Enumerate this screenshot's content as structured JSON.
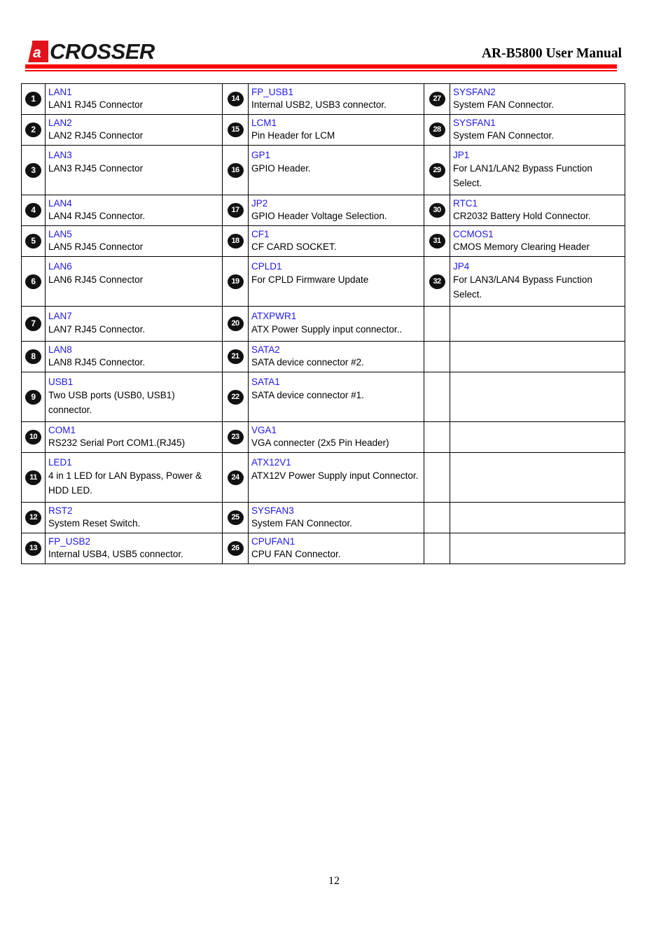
{
  "header": {
    "logo_text": "CROSSER",
    "logo_mark_letter": "a",
    "title": "AR-B5800 User Manual",
    "rule_color": "#fd0000",
    "logo_color": "#e1131d"
  },
  "theme": {
    "title_link_color": "#1f18f0",
    "badge_bg": "#111111",
    "badge_fg": "#ffffff",
    "border_color": "#000000"
  },
  "table": {
    "columns": [
      {
        "items": [
          {
            "num": "1",
            "title": "LAN1",
            "desc": "LAN1 RJ45 Connector"
          },
          {
            "num": "2",
            "title": "LAN2",
            "desc": "LAN2 RJ45 Connector"
          },
          {
            "num": "3",
            "title": "LAN3",
            "desc": "LAN3 RJ45 Connector"
          },
          {
            "num": "4",
            "title": "LAN4",
            "desc": "LAN4 RJ45 Connector."
          },
          {
            "num": "5",
            "title": "LAN5",
            "desc": "LAN5 RJ45 Connector"
          },
          {
            "num": "6",
            "title": "LAN6",
            "desc": "LAN6 RJ45 Connector"
          },
          {
            "num": "7",
            "title": "LAN7",
            "desc": "LAN7 RJ45 Connector."
          },
          {
            "num": "8",
            "title": "LAN8",
            "desc": "LAN8 RJ45 Connector."
          },
          {
            "num": "9",
            "title": "USB1",
            "desc": "Two USB ports (USB0, USB1) connector."
          },
          {
            "num": "10",
            "title": "COM1",
            "desc": "RS232 Serial Port COM1.(RJ45)"
          },
          {
            "num": "11",
            "title": "LED1",
            "desc": "4 in 1 LED for LAN Bypass, Power & HDD LED."
          },
          {
            "num": "12",
            "title": "RST2",
            "desc": "System Reset Switch."
          },
          {
            "num": "13",
            "title": "FP_USB2",
            "desc": "Internal USB4, USB5 connector."
          }
        ]
      },
      {
        "items": [
          {
            "num": "14",
            "title": "FP_USB1",
            "desc": "Internal USB2, USB3 connector."
          },
          {
            "num": "15",
            "title": "LCM1",
            "desc": "Pin Header for LCM"
          },
          {
            "num": "16",
            "title": "GP1",
            "desc": "GPIO Header."
          },
          {
            "num": "17",
            "title": "JP2",
            "desc": "GPIO Header Voltage Selection."
          },
          {
            "num": "18",
            "title": "CF1",
            "desc": "CF CARD SOCKET."
          },
          {
            "num": "19",
            "title": "CPLD1",
            "desc": "For CPLD Firmware Update"
          },
          {
            "num": "20",
            "title": "ATXPWR1",
            "desc": "ATX Power Supply input connector.."
          },
          {
            "num": "21",
            "title": "SATA2",
            "desc": "SATA device connector #2."
          },
          {
            "num": "22",
            "title": "SATA1",
            "desc": "SATA device connector #1."
          },
          {
            "num": "23",
            "title": "VGA1",
            "desc": "VGA connecter (2x5 Pin Header)"
          },
          {
            "num": "24",
            "title": "ATX12V1",
            "desc": "ATX12V Power Supply input Connector."
          },
          {
            "num": "25",
            "title": "SYSFAN3",
            "desc": "System FAN Connector."
          },
          {
            "num": "26",
            "title": "CPUFAN1",
            "desc": "CPU FAN Connector."
          }
        ]
      },
      {
        "items": [
          {
            "num": "27",
            "title": "SYSFAN2",
            "desc": "System FAN Connector."
          },
          {
            "num": "28",
            "title": "SYSFAN1",
            "desc": "System FAN Connector."
          },
          {
            "num": "29",
            "title": "JP1",
            "desc": "For LAN1/LAN2 Bypass Function Select."
          },
          {
            "num": "30",
            "title": "RTC1",
            "desc": "CR2032 Battery Hold Connector."
          },
          {
            "num": "31",
            "title": "CCMOS1",
            "desc": "CMOS Memory Clearing Header"
          },
          {
            "num": "32",
            "title": "JP4",
            "desc": "For LAN3/LAN4 Bypass Function Select."
          },
          {
            "num": "",
            "title": "",
            "desc": ""
          },
          {
            "num": "",
            "title": "",
            "desc": ""
          },
          {
            "num": "",
            "title": "",
            "desc": ""
          },
          {
            "num": "",
            "title": "",
            "desc": ""
          },
          {
            "num": "",
            "title": "",
            "desc": ""
          },
          {
            "num": "",
            "title": "",
            "desc": ""
          },
          {
            "num": "",
            "title": "",
            "desc": ""
          }
        ]
      }
    ]
  },
  "footer": {
    "page_number": "12"
  }
}
